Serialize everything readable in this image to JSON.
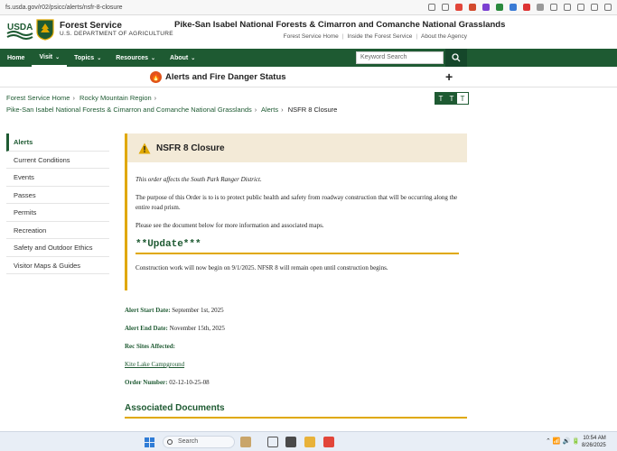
{
  "browser": {
    "url": "fs.usda.gov/r02/psicc/alerts/nsfr-8-closure"
  },
  "header": {
    "usda_logo_text": "USDA",
    "agency_name": "Forest Service",
    "agency_dept": "U.S. DEPARTMENT OF AGRICULTURE",
    "forest_name": "Pike-San Isabel National Forests & Cimarron and Comanche National Grasslands",
    "util_links": [
      "Forest Service Home",
      "Inside the Forest Service",
      "About the Agency"
    ]
  },
  "nav": {
    "items": [
      {
        "label": "Home",
        "caret": ""
      },
      {
        "label": "Visit",
        "caret": "⌄"
      },
      {
        "label": "Topics",
        "caret": "⌄"
      },
      {
        "label": "Resources",
        "caret": "⌄"
      },
      {
        "label": "About",
        "caret": "⌄"
      }
    ],
    "search_placeholder": "Keyword Search"
  },
  "alert_strip": {
    "title": "Alerts and Fire Danger Status"
  },
  "breadcrumb": {
    "items": [
      "Forest Service Home",
      "Rocky Mountain Region",
      "Pike-San Isabel National Forests & Cimarron and Comanche National Grasslands",
      "Alerts"
    ],
    "current": "NSFR 8 Closure"
  },
  "text_size": [
    "T",
    "T",
    "T"
  ],
  "sidebar": {
    "items": [
      "Alerts",
      "Current Conditions",
      "Events",
      "Passes",
      "Permits",
      "Recreation",
      "Safety and Outdoor Ethics",
      "Visitor Maps & Guides"
    ]
  },
  "alert": {
    "title": "NSFR 8 Closure",
    "district_note": "This order affects the South Park Ranger District.",
    "purpose": "The purpose of this Order is to is to protect public health and safety from roadway construction that will be occurring along the entire road prism.",
    "see_doc": "Please see the document below for more information and associated maps.",
    "update_heading": "**Update***",
    "update_text": "Construction work will now begin on 9/1/2025.  NFSR 8 will remain open until construction begins."
  },
  "details": {
    "start_label": "Alert Start Date:",
    "start_value": "September 1st, 2025",
    "end_label": "Alert End Date:",
    "end_value": "November 15th, 2025",
    "rec_label": "Rec Sites Affected:",
    "rec_link": "Kite Lake Campground",
    "order_label": "Order Number:",
    "order_value": "02-12-10-25-08"
  },
  "associated_heading": "Associated Documents",
  "taskbar": {
    "search_label": "Search",
    "time": "10:54 AM",
    "date": "8/26/2025"
  },
  "colors": {
    "brand_green": "#1e5a32",
    "accent_gold": "#e0a800",
    "alert_bg": "#f3ead7",
    "fire_orange": "#e0531a"
  }
}
